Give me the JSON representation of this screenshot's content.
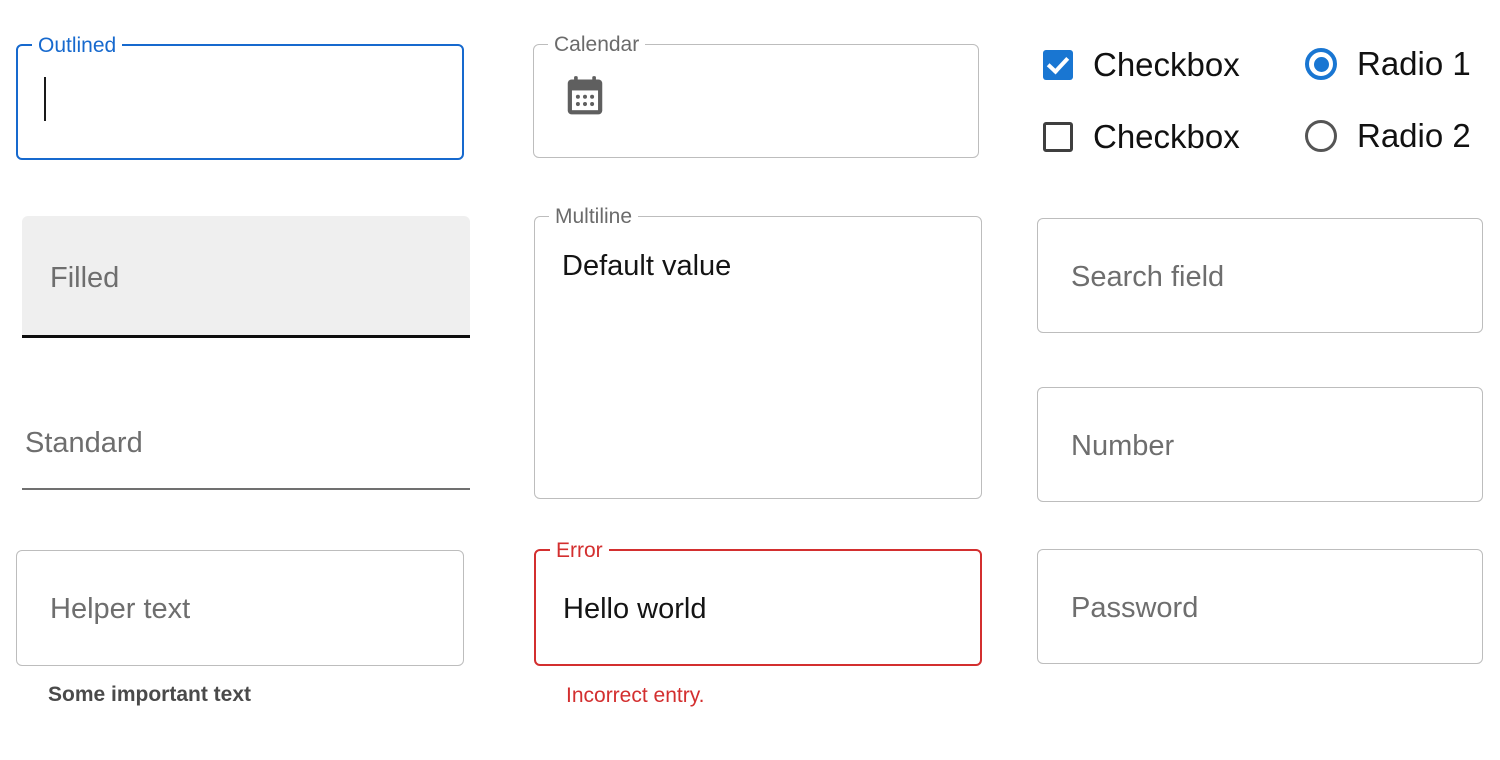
{
  "colors": {
    "focus_blue": "#1669CE",
    "control_blue": "#1976D2",
    "error_red": "#D32F2F",
    "border_gray": "#BDBDBD",
    "placeholder_gray": "#6E6E6E",
    "filled_bg": "#EFEFEF",
    "icon_gray": "#5F5F5F",
    "text_black": "#141414"
  },
  "fields": {
    "outlined": {
      "label": "Outlined",
      "value": "",
      "state": "focused"
    },
    "filled": {
      "placeholder": "Filled",
      "value": "",
      "variant": "filled"
    },
    "standard": {
      "placeholder": "Standard",
      "value": "",
      "variant": "standard"
    },
    "helper_text_field": {
      "placeholder": "Helper text",
      "value": "",
      "helper": "Some important text"
    },
    "calendar": {
      "label": "Calendar",
      "value": "",
      "icon": "calendar-icon"
    },
    "multiline": {
      "label": "Multiline",
      "value": "Default value"
    },
    "error_field": {
      "label": "Error",
      "value": "Hello world",
      "helper": "Incorrect entry.",
      "state": "error"
    },
    "search": {
      "placeholder": "Search field",
      "value": ""
    },
    "number": {
      "placeholder": "Number",
      "value": ""
    },
    "password": {
      "placeholder": "Password",
      "value": ""
    }
  },
  "checkboxes": [
    {
      "label": "Checkbox",
      "checked": true
    },
    {
      "label": "Checkbox",
      "checked": false
    }
  ],
  "radios": [
    {
      "label": "Radio 1",
      "selected": true
    },
    {
      "label": "Radio 2",
      "selected": false
    }
  ]
}
